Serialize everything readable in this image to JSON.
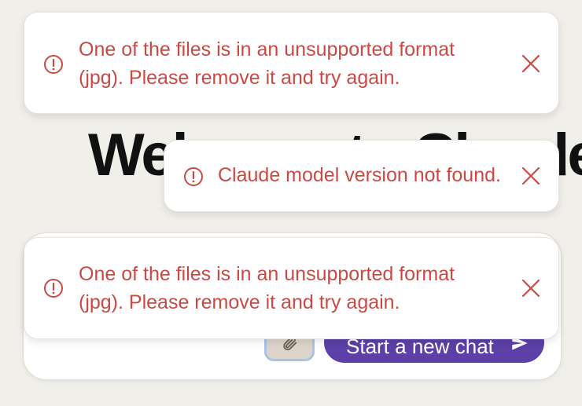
{
  "background": {
    "heading": "Welcome to Claude",
    "start_chat_label": "Start a new chat"
  },
  "toasts": [
    {
      "message": "One of the files is in an unsupported format (jpg). Please remove it and try again.",
      "icon": "alert-circle-icon",
      "close_icon": "close-icon"
    },
    {
      "message": "Claude model version not found.",
      "icon": "alert-circle-icon",
      "close_icon": "close-icon"
    },
    {
      "message": "One of the files is in an unsupported format (jpg). Please remove it and try again.",
      "icon": "alert-circle-icon",
      "close_icon": "close-icon"
    }
  ],
  "colors": {
    "error_text": "#c94a45",
    "page_background": "#f1efea",
    "primary_button": "#5c40a8"
  }
}
